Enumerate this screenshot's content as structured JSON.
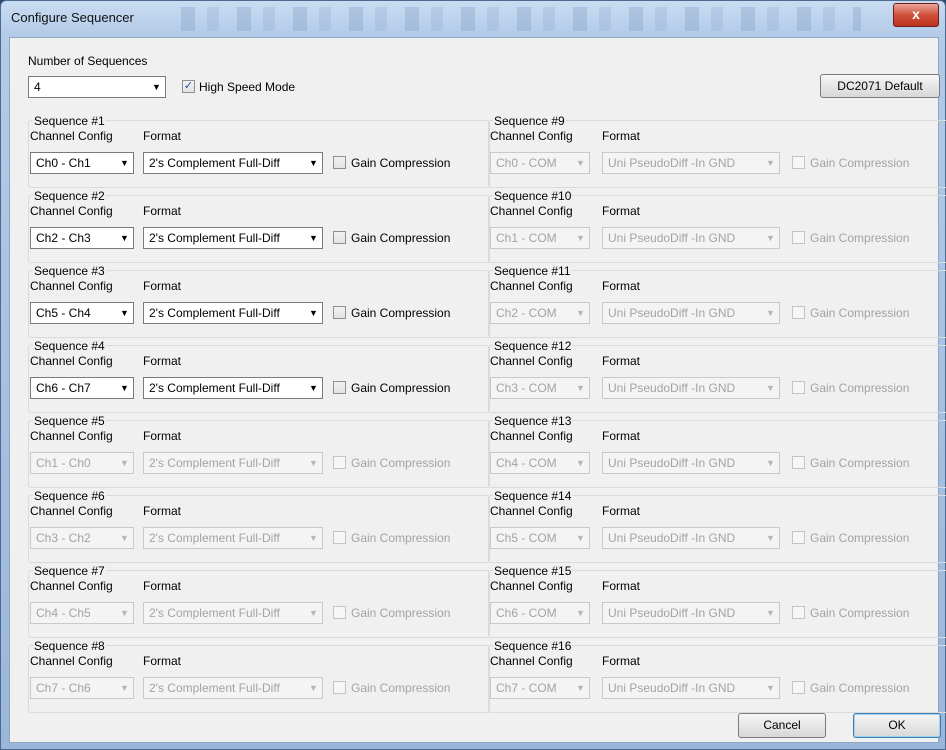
{
  "window": {
    "title": "Configure Sequencer",
    "close_glyph": "x"
  },
  "number_of_sequences": {
    "label": "Number of Sequences",
    "value": "4"
  },
  "high_speed_mode": {
    "label": "High Speed Mode",
    "checked": true
  },
  "buttons": {
    "default": "DC2071 Default",
    "cancel": "Cancel",
    "ok": "OK"
  },
  "headers": {
    "channel_config": "Channel Config",
    "format": "Format"
  },
  "gain_label": "Gain Compression",
  "sequences": [
    {
      "title": "Sequence #1",
      "channel": "Ch0 - Ch1",
      "format": "2's Complement Full-Diff",
      "enabled": true
    },
    {
      "title": "Sequence #2",
      "channel": "Ch2 - Ch3",
      "format": "2's Complement Full-Diff",
      "enabled": true
    },
    {
      "title": "Sequence #3",
      "channel": "Ch5 - Ch4",
      "format": "2's Complement Full-Diff",
      "enabled": true
    },
    {
      "title": "Sequence #4",
      "channel": "Ch6 - Ch7",
      "format": "2's Complement Full-Diff",
      "enabled": true
    },
    {
      "title": "Sequence #5",
      "channel": "Ch1 - Ch0",
      "format": "2's Complement Full-Diff",
      "enabled": false
    },
    {
      "title": "Sequence #6",
      "channel": "Ch3 - Ch2",
      "format": "2's Complement Full-Diff",
      "enabled": false
    },
    {
      "title": "Sequence #7",
      "channel": "Ch4 - Ch5",
      "format": "2's Complement Full-Diff",
      "enabled": false
    },
    {
      "title": "Sequence #8",
      "channel": "Ch7 - Ch6",
      "format": "2's Complement Full-Diff",
      "enabled": false
    },
    {
      "title": "Sequence #9",
      "channel": "Ch0 - COM",
      "format": "Uni PseudoDiff -In GND",
      "enabled": false
    },
    {
      "title": "Sequence #10",
      "channel": "Ch1 - COM",
      "format": "Uni PseudoDiff -In GND",
      "enabled": false
    },
    {
      "title": "Sequence #11",
      "channel": "Ch2 - COM",
      "format": "Uni PseudoDiff -In GND",
      "enabled": false
    },
    {
      "title": "Sequence #12",
      "channel": "Ch3 - COM",
      "format": "Uni PseudoDiff -In GND",
      "enabled": false
    },
    {
      "title": "Sequence #13",
      "channel": "Ch4 - COM",
      "format": "Uni PseudoDiff -In GND",
      "enabled": false
    },
    {
      "title": "Sequence #14",
      "channel": "Ch5 - COM",
      "format": "Uni PseudoDiff -In GND",
      "enabled": false
    },
    {
      "title": "Sequence #15",
      "channel": "Ch6 - COM",
      "format": "Uni PseudoDiff -In GND",
      "enabled": false
    },
    {
      "title": "Sequence #16",
      "channel": "Ch7 - COM",
      "format": "Uni PseudoDiff -In GND",
      "enabled": false
    }
  ]
}
